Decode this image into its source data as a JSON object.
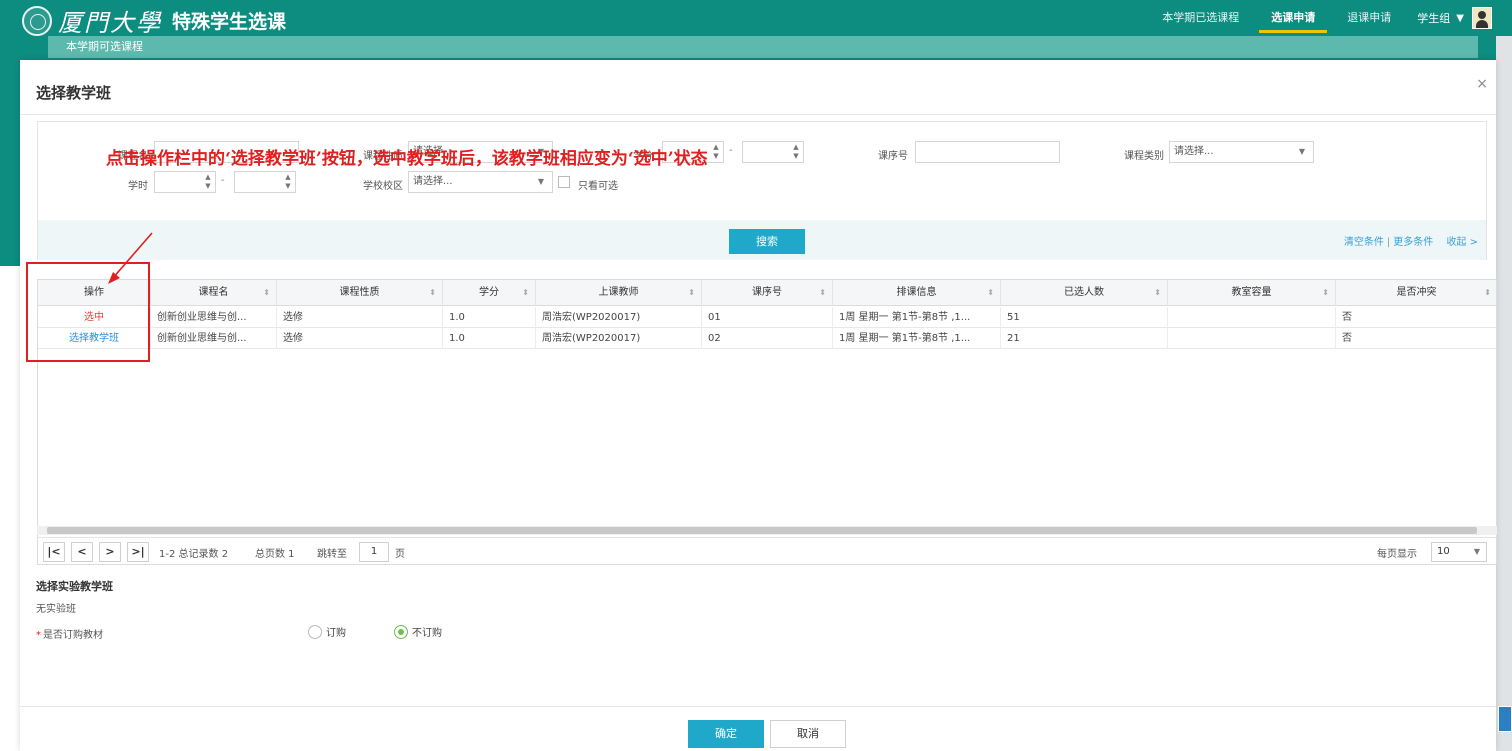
{
  "app": {
    "university": "厦門大學",
    "system_title": "特殊学生选课",
    "nav": [
      "本学期已选课程",
      "选课申请",
      "退课申请"
    ],
    "active_nav": "选课申请",
    "user": "学生组",
    "background_tab": "本学期可选课程"
  },
  "modal": {
    "title": "选择教学班",
    "close": "×",
    "filters": {
      "course_name_label": "课程名",
      "course_nature_label": "课程性质",
      "course_nature_placeholder": "请选择...",
      "credit_label": "学分",
      "course_seq_label": "课序号",
      "course_category_label": "课程类别",
      "course_category_placeholder": "请选择...",
      "hours_label": "学时",
      "campus_label": "学校校区",
      "campus_placeholder": "请选择...",
      "only_available_label": "只看可选",
      "range_separator": "-"
    },
    "annotation": "点击操作栏中的‘选择教学班’按钮，选中教学班后，该教学班相应变为‘选中’状态",
    "search_button": "搜索",
    "links": {
      "clear": "清空条件",
      "sep": "|",
      "more": "更多条件",
      "collapse": "收起 >"
    },
    "table": {
      "columns": [
        "操作",
        "课程名",
        "课程性质",
        "学分",
        "上课教师",
        "课序号",
        "排课信息",
        "已选人数",
        "教室容量",
        "是否冲突"
      ],
      "rows": [
        {
          "op": "选中",
          "name": "创新创业思维与创...",
          "nature": "选修",
          "credit": "1.0",
          "teacher": "周浩宏(WP2020017)",
          "seq": "01",
          "schedule": "1周 星期一 第1节-第8节 ,1...",
          "enrolled": "51",
          "capacity": "",
          "conflict": "否"
        },
        {
          "op": "选择教学班",
          "name": "创新创业思维与创...",
          "nature": "选修",
          "credit": "1.0",
          "teacher": "周浩宏(WP2020017)",
          "seq": "02",
          "schedule": "1周 星期一 第1节-第8节 ,1...",
          "enrolled": "21",
          "capacity": "",
          "conflict": "否"
        }
      ]
    },
    "pager": {
      "first": "|<",
      "prev": "<",
      "next": ">",
      "last": ">|",
      "summary": "1-2 总记录数 2",
      "total_pages": "总页数 1",
      "goto_label": "跳转至",
      "goto_value": "1",
      "page_unit": "页",
      "per_page_label": "每页显示",
      "per_page_value": "10"
    },
    "lab": {
      "title": "选择实验教学班",
      "none": "无实验班"
    },
    "textbook": {
      "label": "是否订购教材",
      "required_mark": "*",
      "options": [
        "订购",
        "不订购"
      ],
      "selected": "不订购"
    },
    "buttons": {
      "ok": "确定",
      "cancel": "取消"
    }
  },
  "colors": {
    "brand": "#0d8c80",
    "accent": "#1fa8c9",
    "annotation": "#e02020",
    "selected_text": "#e0413d",
    "link": "#2f8fd6"
  }
}
